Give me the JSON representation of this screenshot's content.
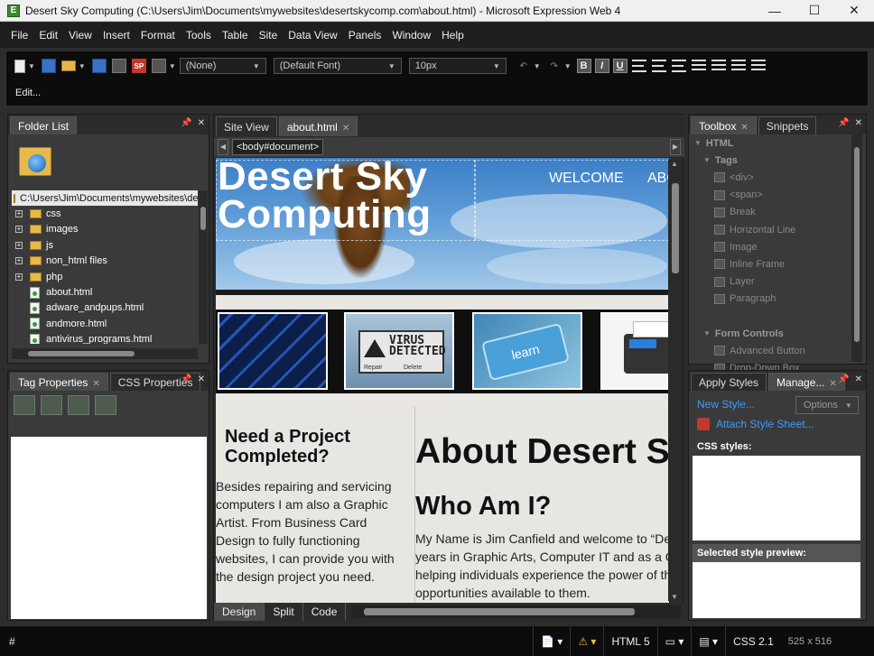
{
  "window": {
    "title": "Desert Sky Computing (C:\\Users\\Jim\\Documents\\mywebsites\\desertskycomp.com\\about.html) - Microsoft Expression Web 4",
    "minimize": "—",
    "maximize": "☐",
    "close": "✕"
  },
  "menu": [
    "File",
    "Edit",
    "View",
    "Insert",
    "Format",
    "Tools",
    "Table",
    "Site",
    "Data View",
    "Panels",
    "Window",
    "Help"
  ],
  "toolbar": {
    "style_select": "(None)",
    "font_select": "(Default Font)",
    "size_select": "10px",
    "bold": "B",
    "italic": "I",
    "underline": "U",
    "edit_label": "Edit..."
  },
  "folder_list": {
    "tab": "Folder List",
    "path": "C:\\Users\\Jim\\Documents\\mywebsites\\des",
    "folders": [
      "css",
      "images",
      "js",
      "non_html files",
      "php"
    ],
    "files": [
      "about.html",
      "adware_andpups.html",
      "andmore.html",
      "antivirus_programs.html"
    ]
  },
  "tag_panel": {
    "tabs": [
      "Tag Properties",
      "CSS Properties"
    ]
  },
  "editor": {
    "tabs": [
      "Site View",
      "about.html"
    ],
    "breadcrumb": "<body#document>",
    "view_tabs": [
      "Design",
      "Split",
      "Code"
    ]
  },
  "page": {
    "site_title": "Desert Sky Computing",
    "nav": [
      "WELCOME",
      "ABO"
    ],
    "thumbs": {
      "virus_text": "VIRUS DETECTED",
      "repair": "Repair",
      "delete": "Delete",
      "learn": "learn"
    },
    "side_heading": "Need a Project Completed?",
    "side_text": "Besides repairing and servicing computers I am also a Graphic Artist.  From Business Card Design to fully functioning websites, I can provide you with the design project you need.",
    "main_heading": "About Desert S",
    "sub_heading": "Who Am I?",
    "main_lines": [
      "My Name is Jim Canfield and welcome to “Dese",
      "years in Graphic Arts, Computer IT and as a Co",
      "helping individuals experience the power of the",
      "opportunities available to them."
    ]
  },
  "toolbox": {
    "tabs": [
      "Toolbox",
      "Snippets"
    ],
    "items": [
      {
        "label": "HTML",
        "kind": "h1"
      },
      {
        "label": "Tags",
        "kind": "h2"
      },
      {
        "label": "<div>",
        "kind": "item"
      },
      {
        "label": "<span>",
        "kind": "item"
      },
      {
        "label": "Break",
        "kind": "item"
      },
      {
        "label": "Horizontal Line",
        "kind": "item"
      },
      {
        "label": "Image",
        "kind": "item"
      },
      {
        "label": "Inline Frame",
        "kind": "item"
      },
      {
        "label": "Layer",
        "kind": "item"
      },
      {
        "label": "Paragraph",
        "kind": "item"
      },
      {
        "label": "",
        "kind": "gap"
      },
      {
        "label": "Form Controls",
        "kind": "h2"
      },
      {
        "label": "Advanced Button",
        "kind": "item"
      },
      {
        "label": "Drop-Down Box",
        "kind": "item"
      }
    ]
  },
  "apply_styles": {
    "tabs": [
      "Apply Styles",
      "Manage..."
    ],
    "new_style": "New Style...",
    "options": "Options",
    "attach": "Attach Style Sheet...",
    "css_styles": "CSS styles:",
    "preview": "Selected style preview:"
  },
  "status": {
    "tag": "#",
    "html": "HTML 5",
    "css": "CSS 2.1",
    "size": "525 x 516"
  },
  "colors": {
    "link": "#3b9bff",
    "toolbar": "#0c0c0c",
    "panel": "#3a3a3a"
  }
}
